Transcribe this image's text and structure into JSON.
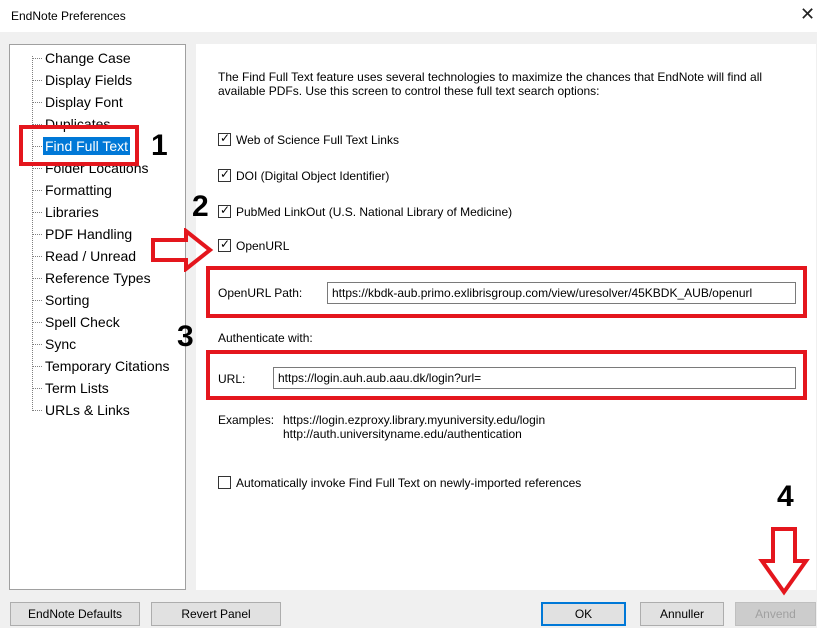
{
  "window": {
    "title": "EndNote Preferences",
    "close_glyph": "✕"
  },
  "sidebar": {
    "items": [
      {
        "label": "Change Case"
      },
      {
        "label": "Display Fields"
      },
      {
        "label": "Display Font"
      },
      {
        "label": "Duplicates"
      },
      {
        "label": "Find Full Text",
        "selected": true
      },
      {
        "label": "Folder Locations"
      },
      {
        "label": "Formatting"
      },
      {
        "label": "Libraries"
      },
      {
        "label": "PDF Handling"
      },
      {
        "label": "Read / Unread"
      },
      {
        "label": "Reference Types"
      },
      {
        "label": "Sorting"
      },
      {
        "label": "Spell Check"
      },
      {
        "label": "Sync"
      },
      {
        "label": "Temporary Citations"
      },
      {
        "label": "Term Lists"
      },
      {
        "label": "URLs & Links"
      }
    ]
  },
  "panel": {
    "intro": "The Find Full Text feature uses several technologies to maximize the chances that EndNote will find all available PDFs. Use this screen to control these full text search options:",
    "options": [
      {
        "label": "Web of Science Full Text Links",
        "checked": true
      },
      {
        "label": "DOI (Digital Object Identifier)",
        "checked": true
      },
      {
        "label": "PubMed LinkOut (U.S. National Library of Medicine)",
        "checked": true
      },
      {
        "label": "OpenURL",
        "checked": true
      }
    ],
    "openurl_path_label": "OpenURL Path:",
    "openurl_path_value": "https://kbdk-aub.primo.exlibrisgroup.com/view/uresolver/45KBDK_AUB/openurl",
    "authenticate_label": "Authenticate with:",
    "url_label": "URL:",
    "url_value": "https://login.auh.aub.aau.dk/login?url=",
    "examples_label": "Examples:",
    "examples": [
      "https://login.ezproxy.library.myuniversity.edu/login",
      "http://auth.universityname.edu/authentication"
    ],
    "auto_invoke_label": "Automatically invoke Find Full Text on newly-imported references",
    "auto_invoke_checked": false,
    "check_glyph": "✓"
  },
  "buttons": {
    "defaults": "EndNote Defaults",
    "revert": "Revert Panel",
    "ok": "OK",
    "cancel": "Annuller",
    "apply": "Anvend"
  },
  "annotations": {
    "step1": "1",
    "step2": "2",
    "step3": "3",
    "step4": "4",
    "color": "#e4161d"
  }
}
